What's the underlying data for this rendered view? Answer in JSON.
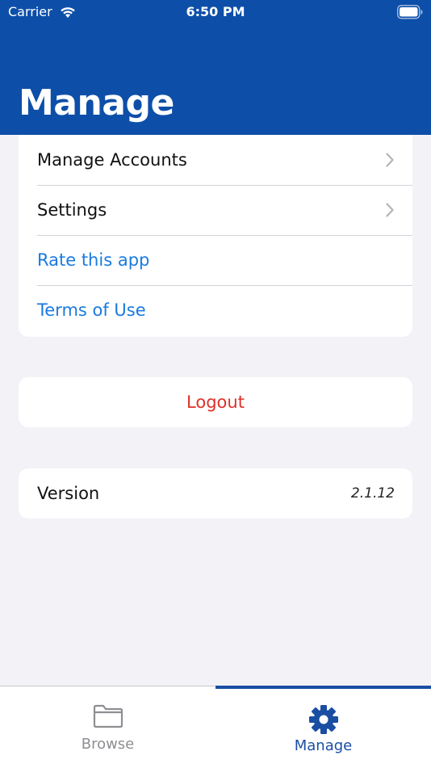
{
  "status_bar": {
    "carrier": "Carrier",
    "time": "6:50 PM",
    "icons": [
      "wifi-icon",
      "battery-icon"
    ]
  },
  "header": {
    "title": "Manage",
    "background_color": "#0d4fa8"
  },
  "menu": {
    "items": [
      {
        "label": "Manage Accounts",
        "style": "default",
        "icon": "chevron-right-icon"
      },
      {
        "label": "Settings",
        "style": "default",
        "icon": "chevron-right-icon"
      },
      {
        "label": "Rate this app",
        "style": "link"
      },
      {
        "label": "Terms of Use",
        "style": "link"
      }
    ]
  },
  "logout": {
    "label": "Logout",
    "color": "#e0302a"
  },
  "version": {
    "label": "Version",
    "value": "2.1.12"
  },
  "tabbar": {
    "tabs": [
      {
        "label": "Browse",
        "icon": "folder-icon",
        "selected": false
      },
      {
        "label": "Manage",
        "icon": "gear-icon",
        "selected": true
      }
    ],
    "accent_color": "#1a4ea3"
  },
  "colors": {
    "link": "#1a7ae0",
    "background": "#f2f2f7"
  }
}
